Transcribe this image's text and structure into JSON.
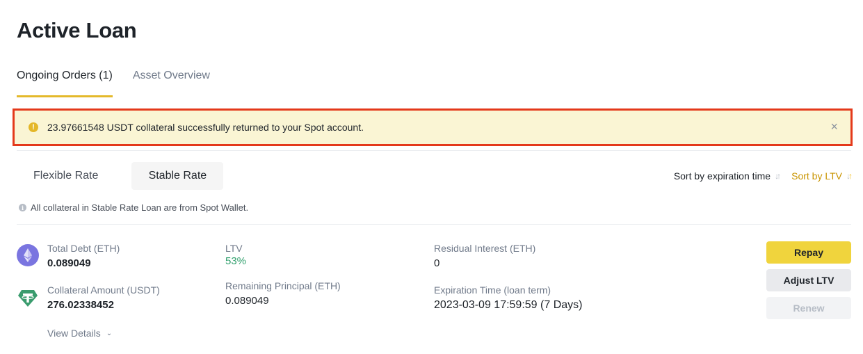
{
  "page": {
    "title": "Active Loan"
  },
  "tabs": [
    {
      "label": "Ongoing Orders (1)",
      "active": true
    },
    {
      "label": "Asset Overview",
      "active": false
    }
  ],
  "alert": {
    "icon": "exclamation-circle-icon",
    "message": "23.97661548 USDT collateral successfully returned to your Spot account.",
    "close_icon": "×"
  },
  "rate_tabs": [
    {
      "label": "Flexible Rate",
      "active": false
    },
    {
      "label": "Stable Rate",
      "active": true
    }
  ],
  "sort": [
    {
      "label": "Sort by expiration time",
      "active": false
    },
    {
      "label": "Sort by LTV",
      "active": true
    }
  ],
  "info_note": "All collateral in Stable Rate Loan are from Spot Wallet.",
  "loan": {
    "total_debt": {
      "label": "Total Debt (ETH)",
      "value": "0.089049"
    },
    "collateral": {
      "label": "Collateral Amount (USDT)",
      "value": "276.02338452"
    },
    "ltv": {
      "label": "LTV",
      "value": "53%"
    },
    "remaining_principal": {
      "label": "Remaining Principal (ETH)",
      "value": "0.089049"
    },
    "residual_interest": {
      "label": "Residual Interest (ETH)",
      "value": "0"
    },
    "expiration": {
      "label": "Expiration Time (loan term)",
      "value": "2023-03-09 17:59:59 (7 Days)"
    },
    "view_details": "View Details"
  },
  "actions": {
    "repay": "Repay",
    "adjust_ltv": "Adjust LTV",
    "renew": "Renew"
  },
  "colors": {
    "accent": "#f0b90b",
    "repay_button": "#f0d43d",
    "alert_bg": "#faf5d4",
    "alert_outline": "#e4391b",
    "ltv_green": "#32a06e",
    "sort_active": "#c99400"
  }
}
